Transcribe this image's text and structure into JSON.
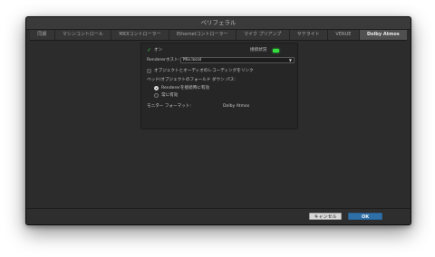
{
  "window": {
    "title": "ペリフェラル"
  },
  "tabs": [
    {
      "label": "同期",
      "active": false
    },
    {
      "label": "マシンコントロール",
      "active": false
    },
    {
      "label": "MIDIコントローラー",
      "active": false
    },
    {
      "label": "Ethernetコントローラー",
      "active": false
    },
    {
      "label": "マイク プリアンプ",
      "active": false
    },
    {
      "label": "サテライト",
      "active": false
    },
    {
      "label": "VENUE",
      "active": false
    },
    {
      "label": "Dolby Atmos",
      "active": true
    }
  ],
  "panel": {
    "on_label": "オン",
    "on_checked": true,
    "connection_status_label": "接続状況",
    "connection_status_color": "#35e03e",
    "renderer_host_label": "Rendererホスト:",
    "renderer_host_value": "Mix.local",
    "record_objects_label": "オブジェクトとオーディオのレコーディングをリンク",
    "record_objects_checked": false,
    "fold_down_label": "ベッド/オブジェクトのフォールド ダウン パス:",
    "radio_renderer_connected": "Rendererを接続時に有効",
    "radio_always": "常に有効",
    "radio_selected": "renderer_connected",
    "monitor_format_label": "モニター フォーマット:",
    "monitor_format_value": "Dolby Atmos"
  },
  "footer": {
    "cancel_label": "キャンセル",
    "ok_label": "OK"
  },
  "colors": {
    "accent": "#2f6fa8",
    "tab_active": "#505050",
    "window_bg": "#2c2c2c"
  }
}
